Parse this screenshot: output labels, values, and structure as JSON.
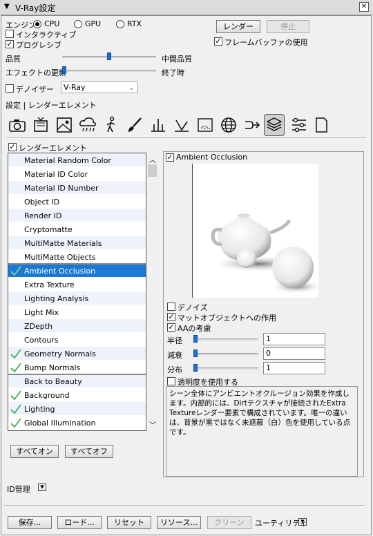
{
  "window": {
    "title": "V-Ray設定"
  },
  "engine": {
    "label": "エンジン",
    "options": [
      "CPU",
      "GPU",
      "RTX"
    ],
    "selected": "CPU"
  },
  "buttons": {
    "render": "レンダー",
    "stop": "停止",
    "all_on": "すべてオン",
    "all_off": "すべてオフ"
  },
  "checks": {
    "interactive": "インタラクティブ",
    "progressive": "プログレシブ",
    "frame_buffer": "フレームバッファの使用",
    "denoiser": "デノイザー"
  },
  "quality": {
    "label": "品質",
    "value_label": "中間品質",
    "level": 0.5
  },
  "effects_update": {
    "label": "エフェクトの更新",
    "value_label": "終了時",
    "level": 0.0
  },
  "denoiser_select": {
    "value": "V-Ray"
  },
  "breadcrumb": {
    "text": "設定 | レンダーエレメント"
  },
  "tabs": [
    "camera",
    "render-output",
    "environment",
    "weather",
    "person",
    "brush",
    "lighting",
    "material",
    "dots",
    "globe",
    "stereo",
    "render-elements",
    "switches",
    "page"
  ],
  "render_elements_toggle": "レンダーエレメント",
  "element_list": [
    {
      "label": "Material Random Color",
      "checked": false
    },
    {
      "label": "Material ID Color",
      "checked": false
    },
    {
      "label": "Material ID Number",
      "checked": false
    },
    {
      "label": "Object ID",
      "checked": false
    },
    {
      "label": "Render ID",
      "checked": false
    },
    {
      "label": "Cryptomatte",
      "checked": false
    },
    {
      "label": "MultiMatte Materials",
      "checked": false
    },
    {
      "label": "MultiMatte Objects",
      "checked": false
    },
    {
      "label": "Ambient Occlusion",
      "checked": true,
      "selected": true
    },
    {
      "label": "Extra Texture",
      "checked": false
    },
    {
      "label": "Lighting Analysis",
      "checked": false
    },
    {
      "label": "Light Mix",
      "checked": false
    },
    {
      "label": "ZDepth",
      "checked": false
    },
    {
      "label": "Contours",
      "checked": false
    },
    {
      "label": "Geometry Normals",
      "checked": true
    },
    {
      "label": "Bump Normals",
      "checked": true
    },
    {
      "label": "Back to Beauty",
      "checked": false
    },
    {
      "label": "Background",
      "checked": true
    },
    {
      "label": "Lighting",
      "checked": true
    },
    {
      "label": "Global Illumination",
      "checked": true
    }
  ],
  "detail": {
    "title": "Ambient Occlusion",
    "denoise": "デノイズ",
    "matte_affect": "マットオブジェクトへの作用",
    "aa_consider": "AAの考慮",
    "params": [
      {
        "label": "半径",
        "value": "1"
      },
      {
        "label": "減衰",
        "value": "0"
      },
      {
        "label": "分布",
        "value": "1"
      }
    ],
    "use_transparency": "透明度を使用する",
    "description": "シーン全体にアンビエントオクルージョン効果を作成します。内部的には、Dirtテクスチャが接続されたExtra Textureレンダー要素で構成されています。唯一の違いは、背景が黒ではなく未遮蔽（白）色を使用している点です。"
  },
  "id_manage": {
    "label": "ID管理"
  },
  "footer": {
    "save": "保存...",
    "load": "ロード...",
    "reset": "リセット",
    "resources": "リソース...",
    "clean": "クリーン",
    "utility": "ユーティリティ"
  }
}
